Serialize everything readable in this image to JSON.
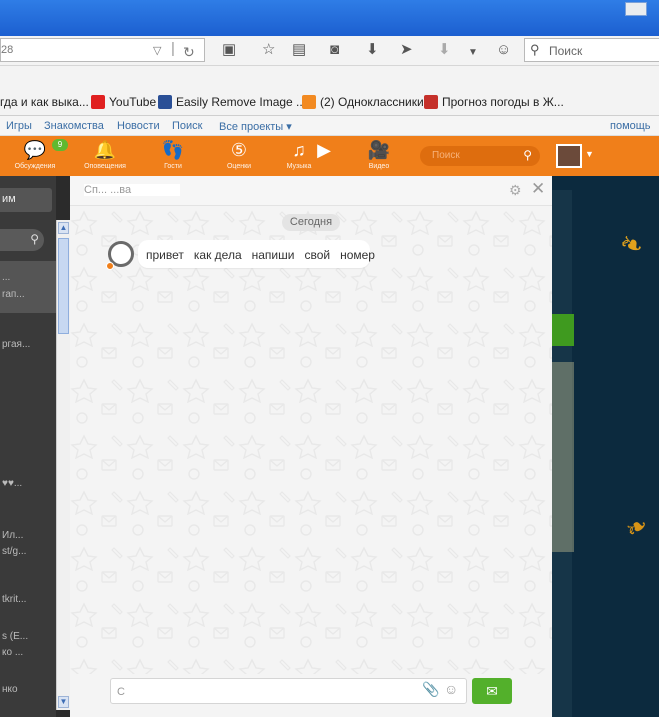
{
  "browser": {
    "url_fragment": "28",
    "search_placeholder": "Поиск",
    "bookmarks": [
      {
        "label": "гда и как выка..."
      },
      {
        "label": "YouTube"
      },
      {
        "label": "Easily Remove Image ..."
      },
      {
        "label": "(2) Одноклассники"
      },
      {
        "label": "Прогноз погоды в Ж..."
      }
    ]
  },
  "ok": {
    "top_links": [
      "Игры",
      "Знакомства",
      "Новости",
      "Поиск",
      "Все проекты ▾"
    ],
    "help": "помощь",
    "nav": [
      {
        "label": "Обсуждения",
        "icon": "discussions-icon"
      },
      {
        "label": "Оповещения",
        "icon": "bell-icon"
      },
      {
        "label": "Гости",
        "icon": "footprints-icon"
      },
      {
        "label": "Оценки",
        "icon": "ratings-icon"
      },
      {
        "label": "Музыка",
        "icon": "music-icon"
      },
      {
        "label": "Видео",
        "icon": "video-icon"
      }
    ],
    "discussions_badge": "9",
    "search_placeholder": "Поиск"
  },
  "left": {
    "button": "им",
    "items": [
      "...",
      "rап...",
      "ргая...",
      "♥♥...",
      "Ил...",
      "st/g...",
      "tkrit...",
      "s (E...",
      "ко ...",
      "нко"
    ]
  },
  "chat": {
    "contact_name": "Сп... ...ва",
    "date_divider": "Сегодня",
    "message": "привет   как дела   напиши   свой   номер",
    "compose_placeholder": "С"
  }
}
